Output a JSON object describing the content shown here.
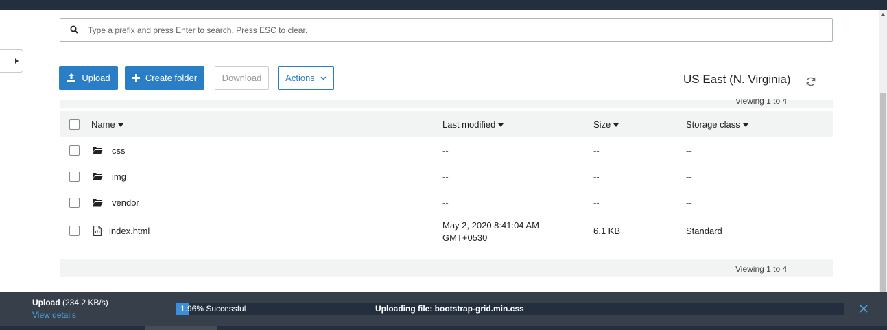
{
  "search": {
    "placeholder": "Type a prefix and press Enter to search. Press ESC to clear."
  },
  "toolbar": {
    "upload_label": "Upload",
    "create_folder_label": "Create folder",
    "download_label": "Download",
    "actions_label": "Actions"
  },
  "region": {
    "label": "US East (N. Virginia)"
  },
  "pagination": {
    "top": "Viewing 1 to 4",
    "bottom": "Viewing 1 to 4"
  },
  "table": {
    "columns": [
      "Name",
      "Last modified",
      "Size",
      "Storage class"
    ],
    "rows": [
      {
        "type": "folder",
        "name": "css",
        "modified": "--",
        "size": "--",
        "storage": "--"
      },
      {
        "type": "folder",
        "name": "img",
        "modified": "--",
        "size": "--",
        "storage": "--"
      },
      {
        "type": "folder",
        "name": "vendor",
        "modified": "--",
        "size": "--",
        "storage": "--"
      },
      {
        "type": "file",
        "name": "index.html",
        "modified_line1": "May 2, 2020 8:41:04 AM",
        "modified_line2": "GMT+0530",
        "size": "6.1 KB",
        "storage": "Standard"
      }
    ]
  },
  "upload": {
    "title": "Upload",
    "speed": "(234.2 KB/s)",
    "view_details": "View details",
    "progress_percent": 1.96,
    "progress_text": "1.96% Successful",
    "file_text": "Uploading file: bootstrap-grid.min.css"
  },
  "colors": {
    "primary": "#2a7ec5",
    "upload_bar": "#37404a",
    "progress": "#3b8fd8",
    "link": "#4aa3df"
  }
}
